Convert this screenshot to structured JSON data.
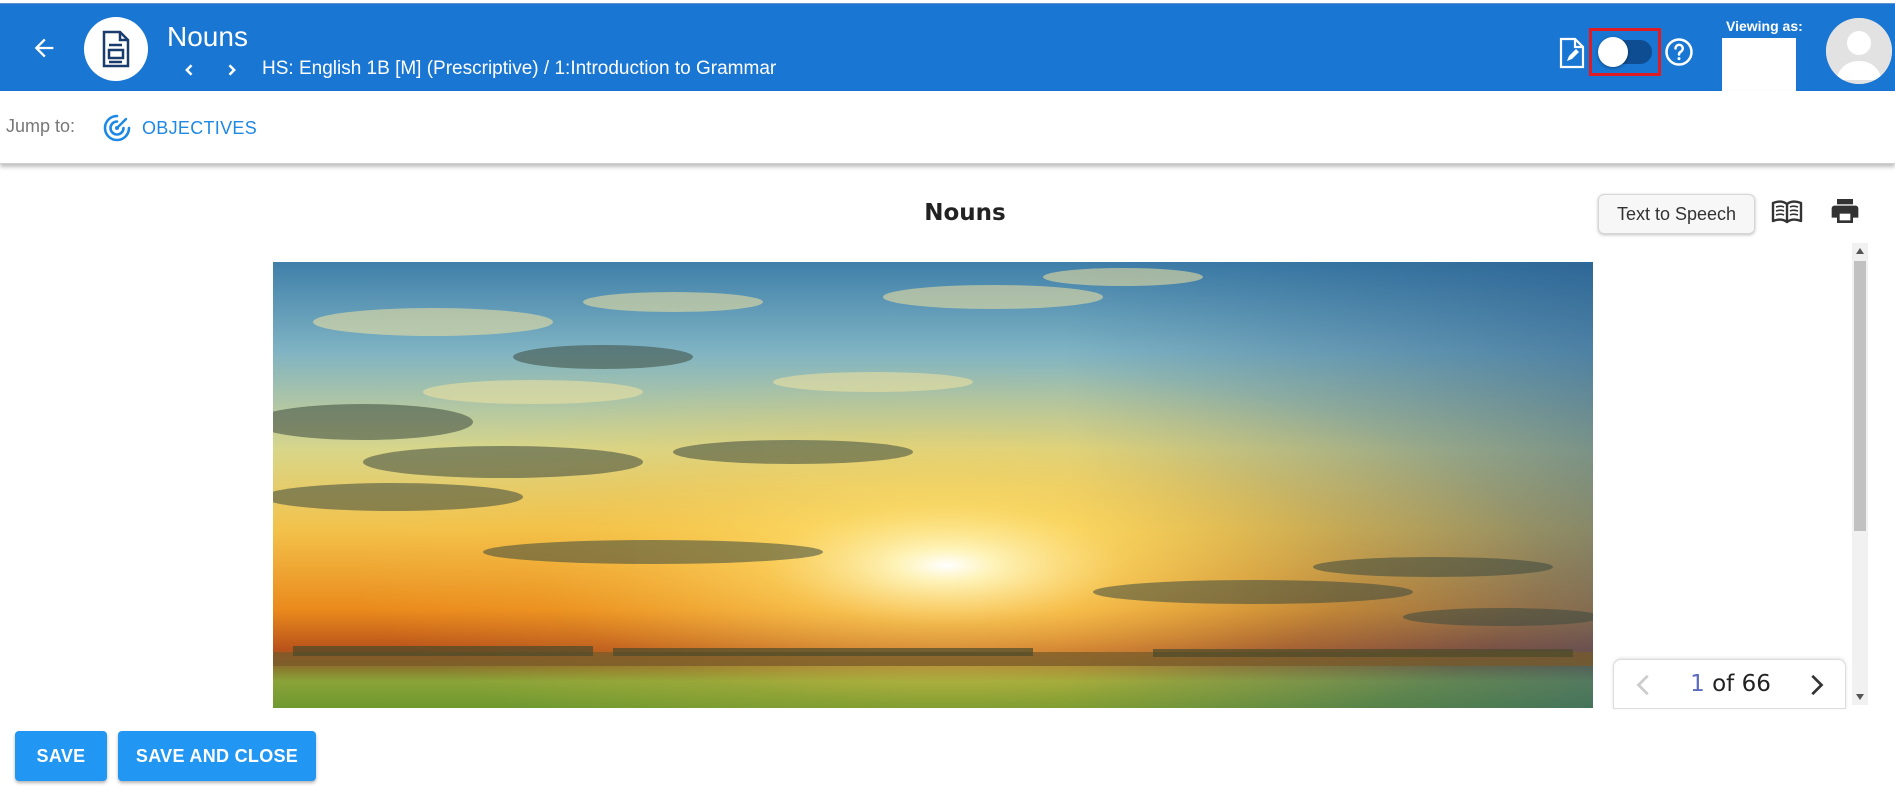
{
  "header": {
    "title": "Nouns",
    "breadcrumb": "HS: English 1B [M] (Prescriptive) / 1:Introduction to Grammar",
    "viewing_as_label": "Viewing as:",
    "colors": {
      "header_bg": "#1976d2",
      "toggle_highlight": "#e01b24"
    },
    "icons": [
      "arrow-left-icon",
      "document-icon",
      "chevron-left-icon",
      "chevron-right-icon",
      "edit-document-icon",
      "help-circle-icon",
      "avatar-icon"
    ]
  },
  "jumpbar": {
    "label": "Jump to:",
    "objectives_label": "OBJECTIVES",
    "icons": [
      "target-icon"
    ]
  },
  "content": {
    "title": "Nouns",
    "tts_label": "Text to Speech",
    "icons": [
      "book-open-icon",
      "printer-icon"
    ],
    "image": "sunset-landscape"
  },
  "pager": {
    "current": "1",
    "of_label": "of 66"
  },
  "footer": {
    "save_label": "SAVE",
    "save_close_label": "SAVE AND CLOSE",
    "button_color": "#2196f3"
  }
}
